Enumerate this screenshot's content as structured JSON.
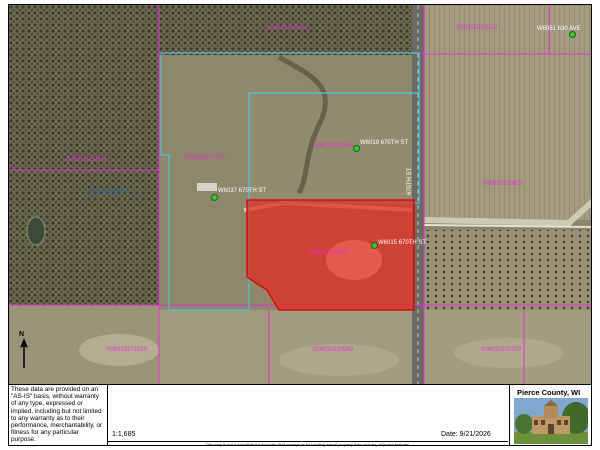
{
  "parcels": [
    {
      "id": "006010200910"
    },
    {
      "id": "006010200510"
    },
    {
      "id": "006010200900"
    },
    {
      "id": "006010271570"
    },
    {
      "id": "006010210560"
    },
    {
      "id": "006010200620"
    },
    {
      "id": "006010210550"
    },
    {
      "id": "006010271520"
    },
    {
      "id": "006010210580"
    },
    {
      "id": "006010200700"
    }
  ],
  "addresses": [
    {
      "text": "W6019 670TH ST"
    },
    {
      "text": "W6037 670TH ST"
    },
    {
      "text": "W6015 670TH ST"
    },
    {
      "text": "W6051 630 AVE"
    }
  ],
  "places": {
    "ellsworth": "ELLSWORTH"
  },
  "roads": {
    "street_670th": "670TH ST"
  },
  "north_arrow": {
    "letter": "N",
    "icon": "north-arrow-icon"
  },
  "footer": {
    "disclaimer": "These data are provided on an \"AS-IS\" basis, without warranty of any type, expressed or implied, including but not limited to any warranty as to their performance, merchantability, or fitness for any particular purpose.",
    "scale": "1:1,685",
    "date": "Date: 9/21/2026",
    "note": "This map is not a substitute for accurate field surveys or for locating actual property lines and any adjacent features.",
    "county": "Pierce County, WI"
  },
  "colors": {
    "parcel_line": "#e22fd6",
    "selection_outline": "#4fc3d9",
    "highlight_fill": "#e8281e",
    "highlight_border": "#d01010"
  }
}
